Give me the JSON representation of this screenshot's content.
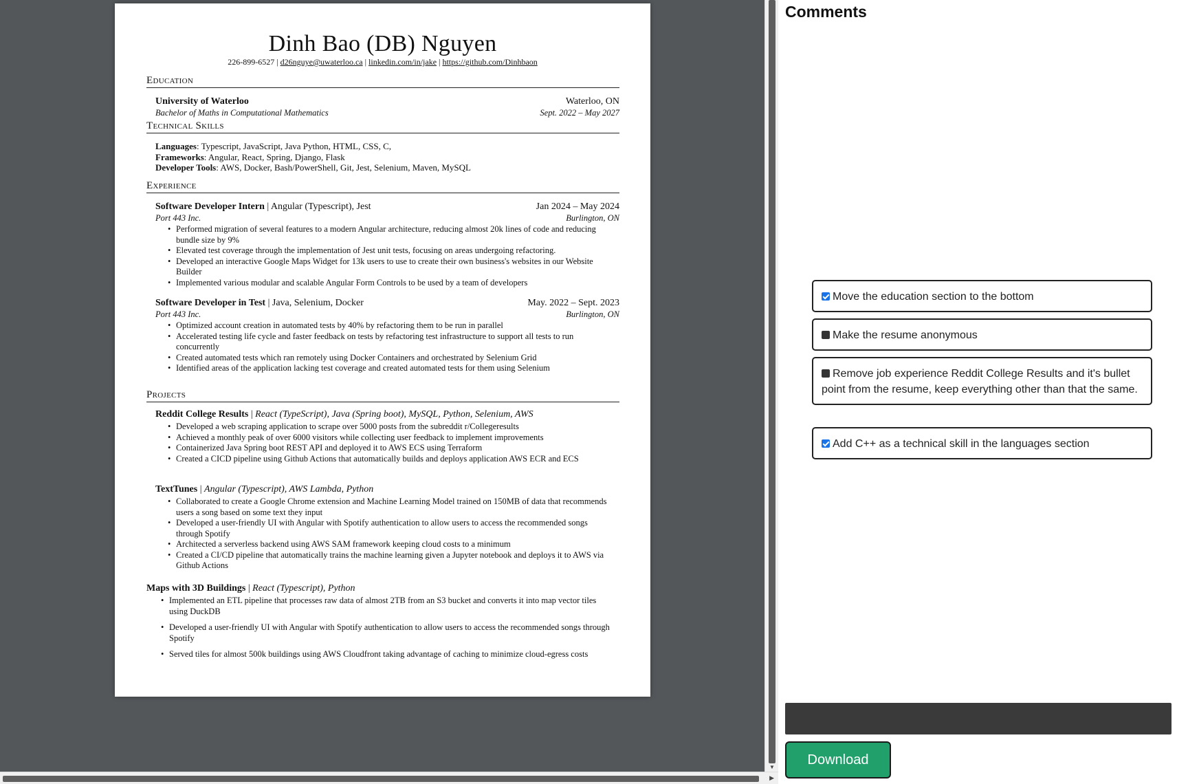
{
  "resume": {
    "name": "Dinh Bao (DB) Nguyen",
    "contact": {
      "phone": "226-899-6527",
      "email": "d26nguye@uwaterloo.ca",
      "linkedin": "linkedin.com/in/jake",
      "github": "https://github.com/Dinhbaon",
      "sep": "|"
    },
    "education": {
      "heading": "Education",
      "school": "University of Waterloo",
      "location": "Waterloo, ON",
      "degree": "Bachelor of Maths in Computational Mathematics",
      "dates": "Sept. 2022 – May 2027"
    },
    "skills": {
      "heading": "Technical Skills",
      "languages_label": "Languages",
      "languages": ": Typescript, JavaScript, Java Python, HTML, CSS, C,",
      "frameworks_label": "Frameworks",
      "frameworks": ": Angular, React, Spring, Django, Flask",
      "tools_label": "Developer Tools",
      "tools": ": AWS, Docker, Bash/PowerShell, Git, Jest, Selenium, Maven, MySQL"
    },
    "experience": {
      "heading": "Experience",
      "jobs": [
        {
          "title": "Software Developer Intern",
          "tech": " | Angular (Typescript), Jest",
          "dates": "Jan 2024 – May 2024",
          "company": "Port 443 Inc.",
          "location": "Burlington, ON",
          "bullets": [
            "Performed migration of several features to a modern Angular architecture, reducing almost 20k lines of code and reducing bundle size by 9%",
            "Elevated test coverage through the implementation of Jest unit tests, focusing on areas undergoing refactoring.",
            "Developed an interactive Google Maps Widget for 13k users to use to create their own business's websites in our Website Builder",
            "Implemented various modular and scalable Angular Form Controls to be used by a team of developers"
          ]
        },
        {
          "title": "Software Developer in Test",
          "tech": " | Java, Selenium, Docker",
          "dates": "May. 2022 – Sept. 2023",
          "company": "Port 443 Inc.",
          "location": "Burlington, ON",
          "bullets": [
            "Optimized account creation in automated tests by 40% by refactoring them to be run in parallel",
            "Accelerated testing life cycle and faster feedback on tests by refactoring test infrastructure to support all tests to run concurrently",
            "Created automated tests which ran remotely using Docker Containers and orchestrated by Selenium Grid",
            "Identified areas of the application lacking test coverage and created automated tests for them using Selenium"
          ]
        }
      ]
    },
    "projects": {
      "heading": "Projects",
      "items": [
        {
          "name": "Reddit College Results",
          "tech": "React (TypeScript), Java (Spring boot), MySQL, Python, Selenium, AWS",
          "bullets": [
            "Developed a web scraping application to scrape over 5000 posts from the subreddit r/Collegeresults",
            "Achieved a monthly peak of over 6000 visitors while collecting user feedback to implement improvements",
            "Containerized Java Spring boot REST API and deployed it to AWS ECS using Terraform",
            "Created a CICD pipeline using Github Actions that automatically builds and deploys application AWS ECR and ECS"
          ]
        },
        {
          "name": "TextTunes",
          "tech": "Angular (Typescript), AWS Lambda, Python",
          "bullets": [
            "Collaborated to create a Google Chrome extension and Machine Learning Model trained on 150MB of data that recommends users a song based on some text they input",
            "Developed a user-friendly UI with Angular with Spotify authentication to allow users to access the recommended songs through Spotify",
            "Architected a serverless backend using AWS SAM framework keeping cloud costs to a minimum",
            "Created a CI/CD pipeline that automatically trains the machine learning given a Jupyter notebook and deploys it to AWS via Github Actions"
          ]
        },
        {
          "name": "Maps with 3D Buildings",
          "tech": "React (Typescript), Python",
          "bullets": [
            "Implemented an ETL pipeline that processes raw data of almost 2TB from an S3 bucket and converts it into map vector tiles using DuckDB",
            "Developed a user-friendly UI with Angular with Spotify authentication to allow users to access the recommended songs through Spotify",
            "Served tiles for almost 500k buildings using AWS Cloudfront taking advantage of caching to minimize cloud-egress costs"
          ]
        }
      ]
    }
  },
  "panel": {
    "title": "Comments",
    "comments": [
      {
        "text": "Move the education section to the bottom",
        "checked": true
      },
      {
        "text": "Make the resume anonymous",
        "checked": false
      },
      {
        "text": "Remove job experience Reddit College Results and it's bullet point from the resume, keep everything other than that the same.",
        "checked": false
      },
      {
        "text": "Add C++ as a technical skill in the languages section",
        "checked": true
      }
    ],
    "input_value": "",
    "download_label": "Download"
  }
}
